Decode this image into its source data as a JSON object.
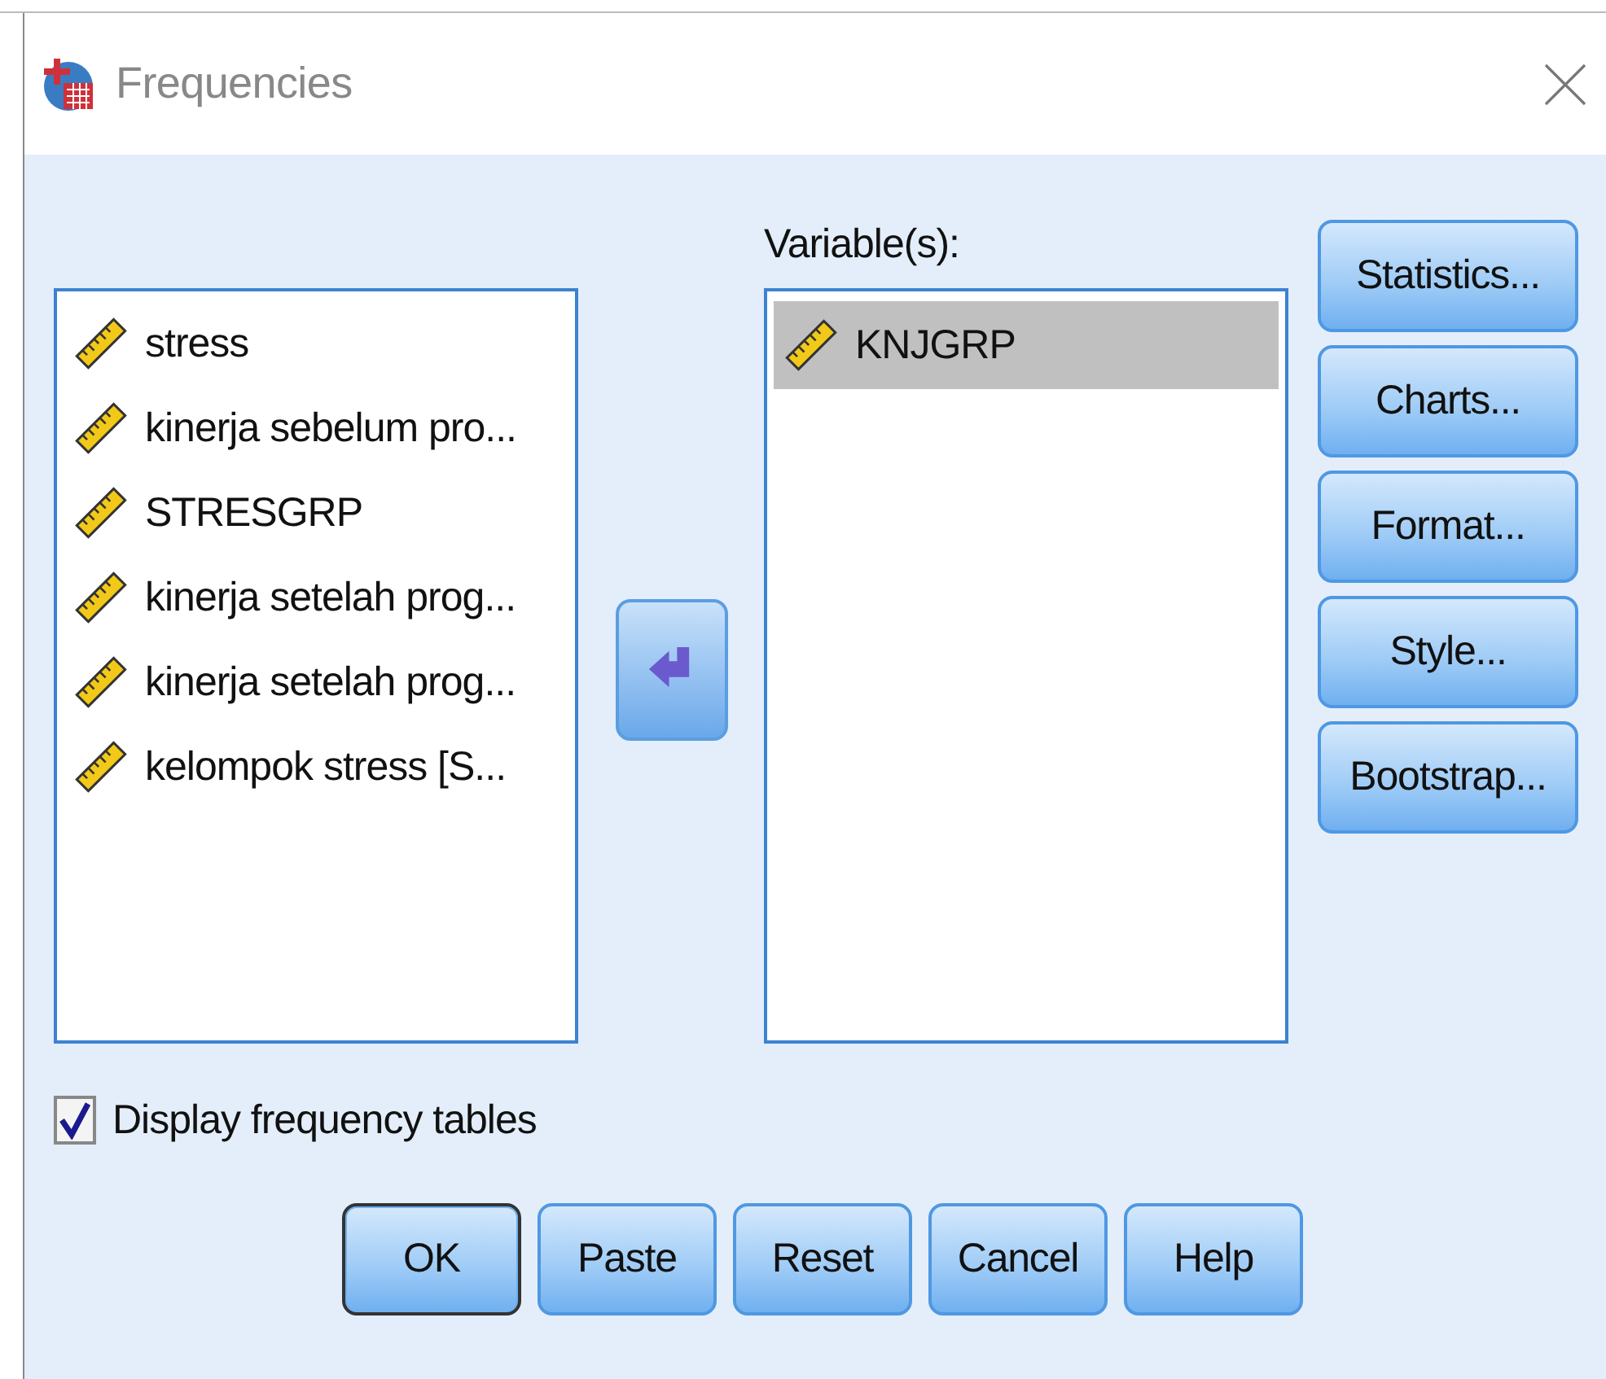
{
  "window": {
    "title": "Frequencies"
  },
  "source_list": {
    "items": [
      {
        "label": "stress",
        "selected": false
      },
      {
        "label": "kinerja sebelum pro...",
        "selected": false
      },
      {
        "label": "STRESGRP",
        "selected": false
      },
      {
        "label": "kinerja setelah prog...",
        "selected": false
      },
      {
        "label": "kinerja setelah prog...",
        "selected": false
      },
      {
        "label": "kelompok stress [S...",
        "selected": false
      }
    ]
  },
  "move_button": {
    "kind": "left"
  },
  "target": {
    "label": "Variable(s):",
    "items": [
      {
        "label": "KNJGRP",
        "selected": true
      }
    ]
  },
  "side_buttons": [
    {
      "label": "Statistics..."
    },
    {
      "label": "Charts..."
    },
    {
      "label": "Format..."
    },
    {
      "label": "Style..."
    },
    {
      "label": "Bootstrap..."
    }
  ],
  "checkbox": {
    "label": "Display frequency tables",
    "checked": true
  },
  "buttons": [
    {
      "label": "OK",
      "default": true
    },
    {
      "label": "Paste",
      "default": false
    },
    {
      "label": "Reset",
      "default": false
    },
    {
      "label": "Cancel",
      "default": false
    },
    {
      "label": "Help",
      "default": false
    }
  ]
}
